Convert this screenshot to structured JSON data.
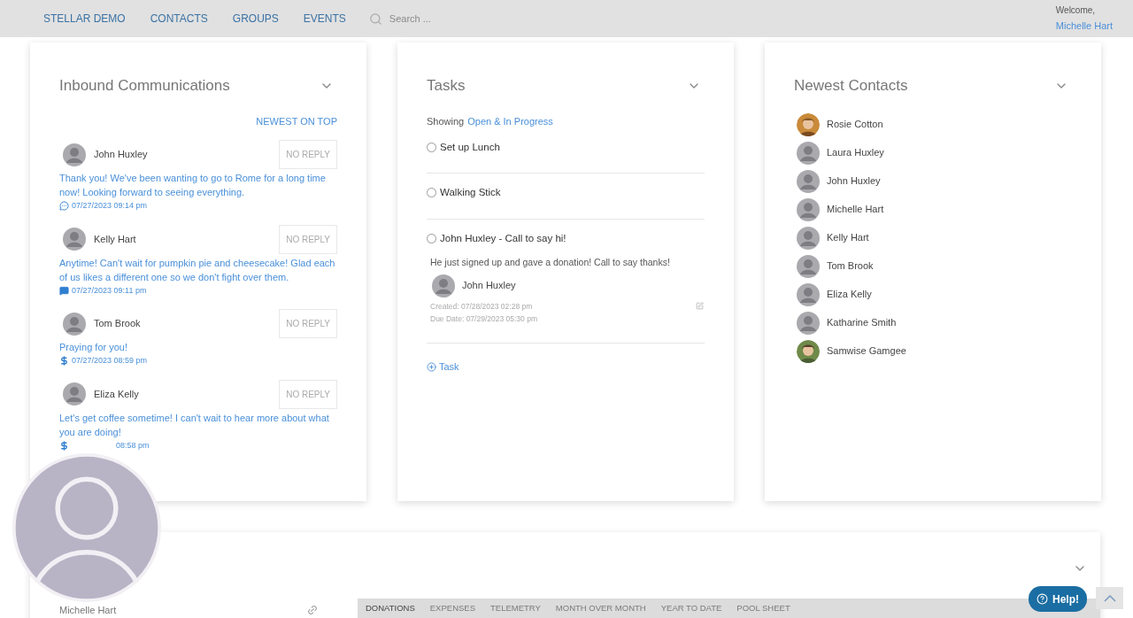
{
  "nav": {
    "items": [
      {
        "label": "STELLAR DEMO"
      },
      {
        "label": "CONTACTS"
      },
      {
        "label": "GROUPS"
      },
      {
        "label": "EVENTS"
      }
    ],
    "search": {
      "placeholder": "Search ..."
    },
    "welcome": "Welcome,",
    "user": "Michelle Hart"
  },
  "inbound": {
    "title": "Inbound Communications",
    "sort": "NEWEST ON TOP",
    "items": [
      {
        "name": "John Huxley",
        "button": "NO REPLY",
        "message": "Thank you! We've been wanting to go to Rome for a long time now! Looking forward to seeing everything.",
        "kind": "chat",
        "date": "07/27/2023 09:14 pm"
      },
      {
        "name": "Kelly Hart",
        "button": "NO REPLY",
        "message": "Anytime! Can't wait for pumpkin pie and cheesecake! Glad each of us likes a different one so we don't fight over them.",
        "kind": "message",
        "date": "07/27/2023 09:11 pm"
      },
      {
        "name": "Tom Brook",
        "button": "NO REPLY",
        "message": "Praying for you!",
        "kind": "donation",
        "date": "07/27/2023 08:59 pm"
      },
      {
        "name": "Eliza Kelly",
        "button": "NO REPLY",
        "message": "Let's get coffee sometime! I can't wait to hear more about what you are doing!",
        "kind": "donation",
        "date": "08:58 pm"
      }
    ]
  },
  "tasks": {
    "title": "Tasks",
    "showing": "Showing",
    "filter": "Open & In Progress",
    "items": [
      {
        "title": "Set up Lunch",
        "checked": false
      },
      {
        "title": "Walking Stick",
        "checked": false
      },
      {
        "title": "John Huxley - Call to say hi!",
        "checked": false,
        "detail": {
          "note": "He just signed up and gave a donation! Call to say thanks!",
          "contact": "John Huxley",
          "created": "Created: 07/28/2023 02:28 pm",
          "due": "Due Date: 07/29/2023 05:30 pm"
        }
      }
    ],
    "add": "Task"
  },
  "contacts": {
    "title": "Newest Contacts",
    "items": [
      {
        "name": "Rosie Cotton"
      },
      {
        "name": "Laura Huxley",
        "kind": "default"
      },
      {
        "name": "John Huxley",
        "kind": "default"
      },
      {
        "name": "Michelle Hart",
        "kind": "default"
      },
      {
        "name": "Kelly Hart",
        "kind": "default"
      },
      {
        "name": "Tom Brook",
        "kind": "default"
      },
      {
        "name": "Eliza Kelly",
        "kind": "default"
      },
      {
        "name": "Katharine Smith",
        "kind": "default"
      },
      {
        "name": "Samwise Gamgee"
      }
    ]
  },
  "profile": {
    "name": "Michelle Hart",
    "tabs": [
      {
        "label": "DONATIONS",
        "selected": true
      },
      {
        "label": "EXPENSES",
        "selected": false
      },
      {
        "label": "TELEMETRY",
        "selected": false
      },
      {
        "label": "MONTH OVER MONTH",
        "selected": false
      },
      {
        "label": "YEAR TO DATE",
        "selected": false
      },
      {
        "label": "POOL SHEET",
        "selected": false
      }
    ]
  },
  "help": {
    "label": "Help!"
  }
}
